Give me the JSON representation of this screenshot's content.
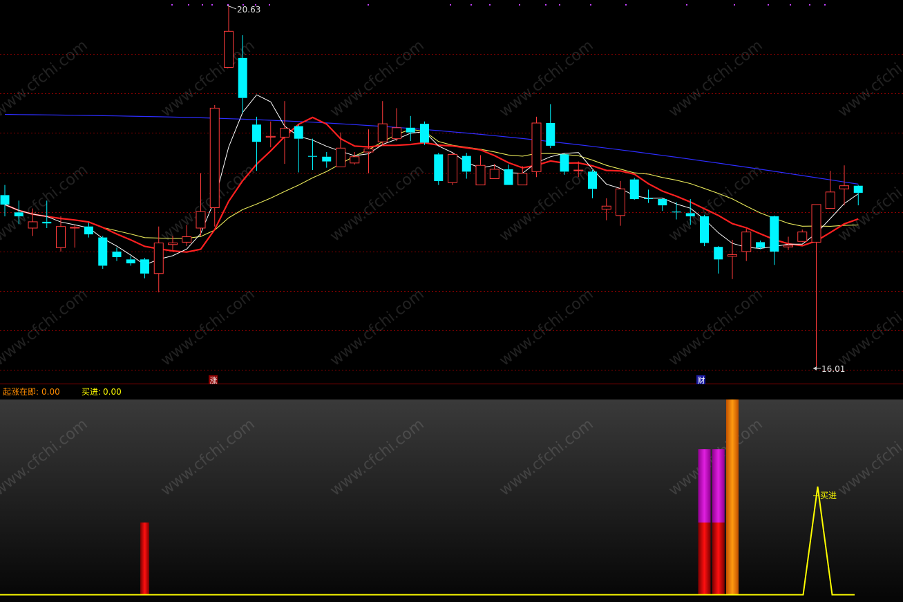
{
  "colors": {
    "up": "#ff3b3b",
    "down": "#00f5ff",
    "ma5": "#ffffff",
    "ma10": "#ff2020",
    "ma30": "#e8e85a",
    "ma60": "#2d2dff",
    "grid": "#8b0000",
    "indicator_label": "#ff8c00",
    "buy_label": "#ffff00"
  },
  "watermark": "www.cfchi.com",
  "price_panel": {
    "high_label": "20.63",
    "low_label": "16.01",
    "marker_zhang": "涨",
    "marker_cai": "财"
  },
  "indicator": {
    "qizhang_label": "起涨在即:",
    "qizhang_value": "0.00",
    "buy_label": "买进:",
    "buy_value": "0.00",
    "buy_annotation": "买进"
  },
  "chart_data": [
    {
      "type": "candlestick",
      "title": "",
      "y_high": 20.63,
      "y_low": 16.01,
      "candles": [
        {
          "o": 18.22,
          "c": 18.1,
          "h": 18.35,
          "l": 17.95
        },
        {
          "o": 18.0,
          "c": 17.95,
          "h": 18.15,
          "l": 17.85
        },
        {
          "o": 17.8,
          "c": 17.88,
          "h": 18.05,
          "l": 17.7
        },
        {
          "o": 17.88,
          "c": 17.86,
          "h": 18.15,
          "l": 17.8
        },
        {
          "o": 17.55,
          "c": 17.82,
          "h": 17.95,
          "l": 17.5
        },
        {
          "o": 17.8,
          "c": 17.81,
          "h": 17.84,
          "l": 17.55
        },
        {
          "o": 17.82,
          "c": 17.72,
          "h": 17.87,
          "l": 17.68
        },
        {
          "o": 17.68,
          "c": 17.32,
          "h": 17.7,
          "l": 17.28
        },
        {
          "o": 17.5,
          "c": 17.43,
          "h": 17.55,
          "l": 17.38
        },
        {
          "o": 17.4,
          "c": 17.35,
          "h": 17.44,
          "l": 17.32
        },
        {
          "o": 17.4,
          "c": 17.22,
          "h": 17.42,
          "l": 17.16
        },
        {
          "o": 17.22,
          "c": 17.61,
          "h": 17.82,
          "l": 16.98
        },
        {
          "o": 17.59,
          "c": 17.61,
          "h": 17.7,
          "l": 17.52
        },
        {
          "o": 17.62,
          "c": 17.69,
          "h": 17.84,
          "l": 17.57
        },
        {
          "o": 17.8,
          "c": 18.01,
          "h": 18.5,
          "l": 17.7
        },
        {
          "o": 18.06,
          "c": 19.33,
          "h": 19.37,
          "l": 17.82
        },
        {
          "o": 19.85,
          "c": 20.31,
          "h": 20.63,
          "l": 19.85
        },
        {
          "o": 19.97,
          "c": 19.46,
          "h": 20.26,
          "l": 19.27
        },
        {
          "o": 19.12,
          "c": 18.9,
          "h": 19.22,
          "l": 18.53
        },
        {
          "o": 18.96,
          "c": 18.97,
          "h": 19.16,
          "l": 18.83
        },
        {
          "o": 18.96,
          "c": 19.07,
          "h": 19.42,
          "l": 18.62
        },
        {
          "o": 19.1,
          "c": 18.94,
          "h": 19.12,
          "l": 18.51
        },
        {
          "o": 18.72,
          "c": 18.71,
          "h": 18.94,
          "l": 18.54
        },
        {
          "o": 18.71,
          "c": 18.65,
          "h": 18.77,
          "l": 18.57
        },
        {
          "o": 18.58,
          "c": 18.82,
          "h": 19.02,
          "l": 18.58
        },
        {
          "o": 18.63,
          "c": 18.71,
          "h": 18.77,
          "l": 18.61
        },
        {
          "o": 18.77,
          "c": 18.81,
          "h": 19.06,
          "l": 18.5
        },
        {
          "o": 18.9,
          "c": 19.13,
          "h": 19.42,
          "l": 18.86
        },
        {
          "o": 18.94,
          "c": 19.08,
          "h": 19.33,
          "l": 18.91
        },
        {
          "o": 19.08,
          "c": 19.02,
          "h": 19.23,
          "l": 18.91
        },
        {
          "o": 19.13,
          "c": 18.89,
          "h": 19.16,
          "l": 18.86
        },
        {
          "o": 18.74,
          "c": 18.4,
          "h": 18.76,
          "l": 18.35
        },
        {
          "o": 18.38,
          "c": 18.74,
          "h": 18.76,
          "l": 18.35
        },
        {
          "o": 18.72,
          "c": 18.52,
          "h": 18.76,
          "l": 18.43
        },
        {
          "o": 18.35,
          "c": 18.6,
          "h": 18.73,
          "l": 18.35
        },
        {
          "o": 18.43,
          "c": 18.55,
          "h": 18.62,
          "l": 18.43
        },
        {
          "o": 18.55,
          "c": 18.35,
          "h": 18.61,
          "l": 18.35
        },
        {
          "o": 18.35,
          "c": 18.5,
          "h": 18.59,
          "l": 18.35
        },
        {
          "o": 18.52,
          "c": 19.14,
          "h": 19.22,
          "l": 18.45
        },
        {
          "o": 19.14,
          "c": 18.85,
          "h": 19.38,
          "l": 18.82
        },
        {
          "o": 18.74,
          "c": 18.52,
          "h": 18.75,
          "l": 18.48
        },
        {
          "o": 18.54,
          "c": 18.54,
          "h": 18.65,
          "l": 18.45
        },
        {
          "o": 18.52,
          "c": 18.3,
          "h": 18.54,
          "l": 18.18
        },
        {
          "o": 18.04,
          "c": 18.08,
          "h": 18.18,
          "l": 17.9
        },
        {
          "o": 17.96,
          "c": 18.3,
          "h": 18.4,
          "l": 17.83
        },
        {
          "o": 18.42,
          "c": 18.17,
          "h": 18.44,
          "l": 18.16
        },
        {
          "o": 18.18,
          "c": 18.17,
          "h": 18.29,
          "l": 18.12
        },
        {
          "o": 18.17,
          "c": 18.09,
          "h": 18.18,
          "l": 18.02
        },
        {
          "o": 18.01,
          "c": 18.0,
          "h": 18.13,
          "l": 17.91
        },
        {
          "o": 17.99,
          "c": 17.95,
          "h": 18.17,
          "l": 17.84
        },
        {
          "o": 17.95,
          "c": 17.61,
          "h": 17.97,
          "l": 17.57
        },
        {
          "o": 17.56,
          "c": 17.4,
          "h": 17.57,
          "l": 17.22
        },
        {
          "o": 17.44,
          "c": 17.46,
          "h": 17.65,
          "l": 17.15
        },
        {
          "o": 17.5,
          "c": 17.75,
          "h": 17.79,
          "l": 17.38
        },
        {
          "o": 17.62,
          "c": 17.55,
          "h": 17.64,
          "l": 17.53
        },
        {
          "o": 17.95,
          "c": 17.5,
          "h": 17.96,
          "l": 17.33
        },
        {
          "o": 17.56,
          "c": 17.58,
          "h": 17.69,
          "l": 17.52
        },
        {
          "o": 17.63,
          "c": 17.75,
          "h": 17.78,
          "l": 17.62
        },
        {
          "o": 17.62,
          "c": 18.1,
          "h": 18.1,
          "l": 16.01
        },
        {
          "o": 18.05,
          "c": 18.26,
          "h": 18.53,
          "l": 18.05
        },
        {
          "o": 18.3,
          "c": 18.34,
          "h": 18.6,
          "l": 18.09
        },
        {
          "o": 18.34,
          "c": 18.25,
          "h": 18.35,
          "l": 18.09
        }
      ]
    },
    {
      "type": "bar",
      "title": "",
      "series": [
        {
          "name": "起涨在即",
          "color": "#ff0000",
          "bars": [
            {
              "index": 10,
              "value": 1
            },
            {
              "index": 50,
              "value": 1
            },
            {
              "index": 51,
              "value": 1
            }
          ]
        },
        {
          "color": "#c000c0",
          "bars": [
            {
              "index": 50,
              "value": 2
            },
            {
              "index": 51,
              "value": 2
            }
          ]
        },
        {
          "color": "#ff8c00",
          "bars": [
            {
              "index": 52,
              "value": 3
            }
          ]
        }
      ]
    },
    {
      "type": "line",
      "title": "",
      "series": [
        {
          "name": "买进",
          "color": "#ffff00",
          "peak_index": 58,
          "peak_value": 1.5
        }
      ]
    }
  ]
}
